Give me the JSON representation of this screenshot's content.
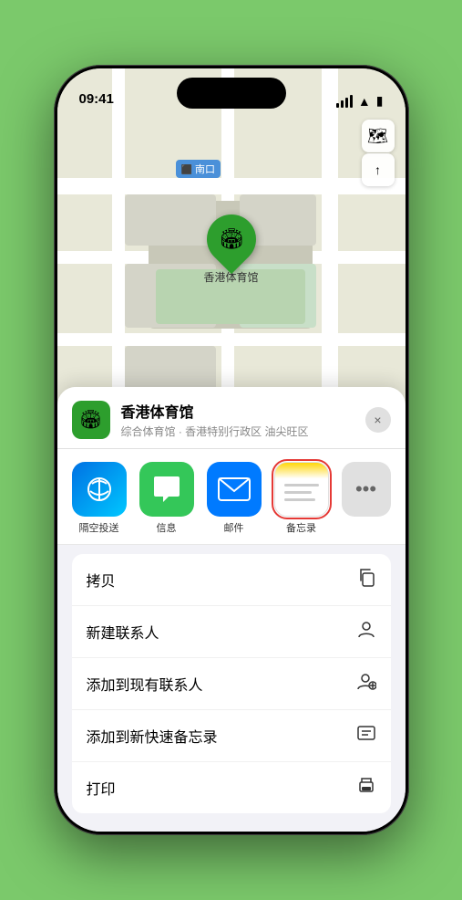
{
  "status": {
    "time": "09:41",
    "signal_label": "signal",
    "wifi_label": "wifi",
    "battery_label": "battery"
  },
  "map": {
    "label_text": "南口",
    "pin_label": "香港体育馆",
    "pin_emoji": "🏟"
  },
  "map_controls": {
    "layers_icon": "🗺",
    "location_icon": "⬆"
  },
  "sheet": {
    "venue_name": "香港体育馆",
    "venue_desc": "综合体育馆 · 香港特别行政区 油尖旺区",
    "venue_emoji": "🏟",
    "close_label": "×"
  },
  "apps": [
    {
      "id": "airdrop",
      "label": "隔空投送",
      "type": "airdrop"
    },
    {
      "id": "messages",
      "label": "信息",
      "type": "messages"
    },
    {
      "id": "mail",
      "label": "邮件",
      "type": "mail"
    },
    {
      "id": "notes",
      "label": "备忘录",
      "type": "notes",
      "selected": true
    }
  ],
  "more_icon": "⋯",
  "actions": [
    {
      "id": "copy",
      "label": "拷贝",
      "icon": "⎘"
    },
    {
      "id": "new-contact",
      "label": "新建联系人",
      "icon": "👤"
    },
    {
      "id": "add-contact",
      "label": "添加到现有联系人",
      "icon": "➕"
    },
    {
      "id": "quick-note",
      "label": "添加到新快速备忘录",
      "icon": "📋"
    },
    {
      "id": "print",
      "label": "打印",
      "icon": "🖨"
    }
  ]
}
